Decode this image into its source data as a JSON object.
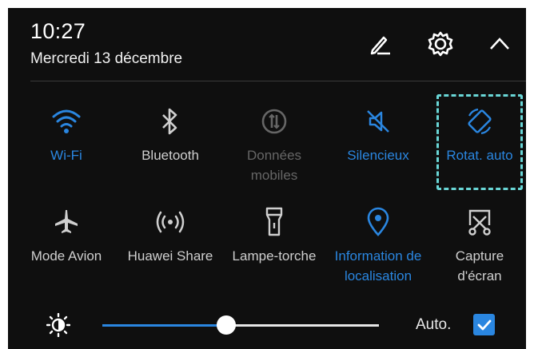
{
  "status": {
    "time": "10:27",
    "date": "Mercredi 13 décembre"
  },
  "header_icons": [
    "edit-icon",
    "settings-icon",
    "collapse-icon"
  ],
  "tiles_row1": [
    {
      "label": "Wi-Fi",
      "icon": "wifi-icon",
      "state": "on"
    },
    {
      "label": "Bluetooth",
      "icon": "bluetooth-icon",
      "state": "off"
    },
    {
      "label_line1": "Données",
      "label_line2": "mobiles",
      "icon": "mobile-data-icon",
      "state": "disabled"
    },
    {
      "label": "Silencieux",
      "icon": "silent-icon",
      "state": "on"
    },
    {
      "label": "Rotat. auto",
      "icon": "auto-rotate-icon",
      "state": "on"
    }
  ],
  "tiles_row2": [
    {
      "label": "Mode Avion",
      "icon": "airplane-icon",
      "state": "off"
    },
    {
      "label": "Huawei Share",
      "icon": "huawei-share-icon",
      "state": "off"
    },
    {
      "label": "Lampe-torche",
      "icon": "flashlight-icon",
      "state": "off"
    },
    {
      "label_line1": "Information de",
      "label_line2": "localisation",
      "icon": "location-icon",
      "state": "on"
    },
    {
      "label_line1": "Capture",
      "label_line2": "d'écran",
      "icon": "screenshot-icon",
      "state": "off"
    }
  ],
  "brightness": {
    "level": 0.45,
    "auto_label": "Auto.",
    "auto_checked": true
  },
  "colors": {
    "background": "#0f0f0f",
    "accent": "#2a86e0",
    "inactive": "#cfcfcf",
    "disabled": "#666666",
    "focus_outline": "#69d6d6"
  }
}
